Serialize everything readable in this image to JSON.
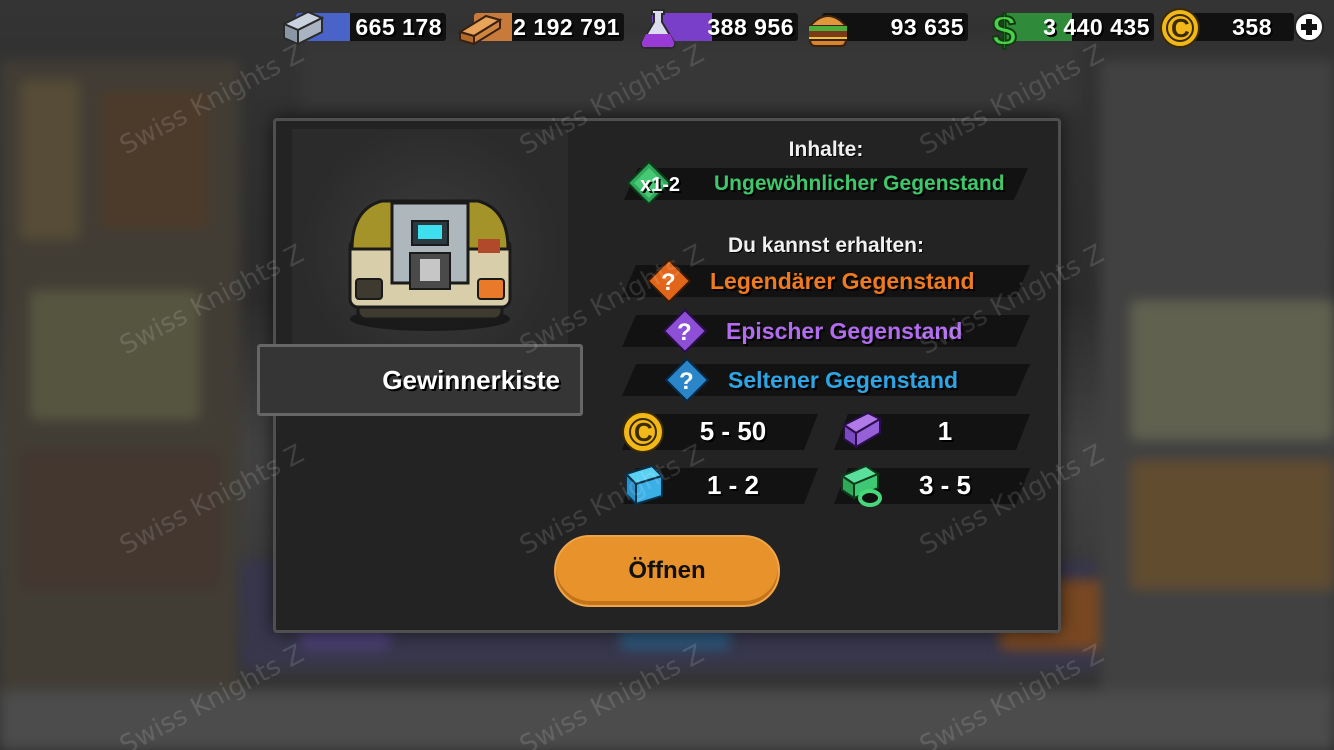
{
  "resources": [
    {
      "name": "steel-icon",
      "value": "665 178",
      "color": "#4a63c9"
    },
    {
      "name": "wood-icon",
      "value": "2 192 791",
      "color": "#c77a3a"
    },
    {
      "name": "potion-icon",
      "value": "388 956",
      "color": "#7a3fc9"
    },
    {
      "name": "burger-icon",
      "value": "93 635",
      "color": "#3a3a3a"
    },
    {
      "name": "dollar-icon",
      "value": "3 440 435",
      "color": "#2f8a3a"
    },
    {
      "name": "coin-icon",
      "value": "358",
      "color": "#3a3a3a"
    }
  ],
  "watermark": "Swiss Knights Z",
  "modal": {
    "chest_name": "Gewinnerkiste",
    "contents_title": "Inhalte:",
    "guaranteed": {
      "qty": "x1-2",
      "label": "Ungewöhnlicher Gegenstand",
      "color": "#3ec86a"
    },
    "possible_title": "Du kannst erhalten:",
    "possible": [
      {
        "label": "Legendärer Gegenstand",
        "color": "#f07a1e",
        "gem": "#e2661a"
      },
      {
        "label": "Epischer Gegenstand",
        "color": "#b36cf0",
        "gem": "#8c4fd6"
      },
      {
        "label": "Seltener Gegenstand",
        "color": "#2ea6e6",
        "gem": "#2a86c8"
      }
    ],
    "rewards": [
      {
        "icon": "coin-icon",
        "value": "5 - 50"
      },
      {
        "icon": "purple-blueprint-icon",
        "value": "1"
      },
      {
        "icon": "blue-blueprint-icon",
        "value": "1 - 2"
      },
      {
        "icon": "green-blueprint-icon",
        "value": "3 - 5"
      }
    ],
    "open_label": "Öffnen"
  },
  "colors": {
    "button": "#e7922a",
    "modal_bg": "#232323"
  }
}
